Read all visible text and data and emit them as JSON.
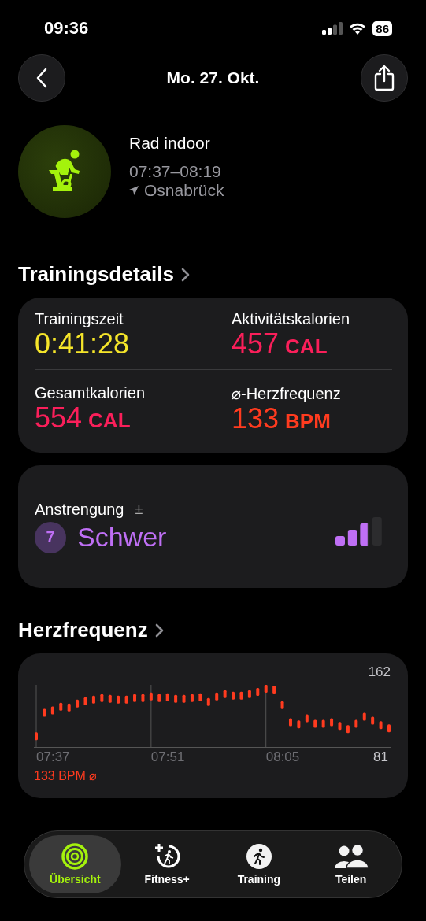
{
  "status_bar": {
    "time": "09:36",
    "battery": "86"
  },
  "nav": {
    "title": "Mo. 27. Okt."
  },
  "workout": {
    "name": "Rad indoor",
    "time_range": "07:37–08:19",
    "location": "Osnabrück"
  },
  "details": {
    "title": "Trainingsdetails",
    "metrics": [
      {
        "label": "Trainingszeit",
        "value": "0:41:28",
        "color": "#f5e52a"
      },
      {
        "label": "Aktivitätskalorien",
        "value": "457",
        "unit": "CAL",
        "color": "#fa1f5a"
      },
      {
        "label": "Gesamtkalorien",
        "value": "554",
        "unit": "CAL",
        "color": "#fa1f5a"
      },
      {
        "label": "⌀-Herzfrequenz",
        "value": "133",
        "unit": "BPM",
        "color": "#ff3b1f"
      }
    ]
  },
  "effort": {
    "label": "Anstrengung",
    "adjust": "±",
    "score": "7",
    "rating": "Schwer"
  },
  "heart_rate": {
    "title": "Herzfrequenz",
    "average": "133 BPM ⌀",
    "max_label": "162",
    "min_label": "81",
    "time_labels": [
      "07:37",
      "07:51",
      "08:05"
    ]
  },
  "tabs": [
    {
      "label": "Übersicht",
      "selected": true
    },
    {
      "label": "Fitness+",
      "selected": false
    },
    {
      "label": "Training",
      "selected": false
    },
    {
      "label": "Teilen",
      "selected": false
    }
  ]
}
